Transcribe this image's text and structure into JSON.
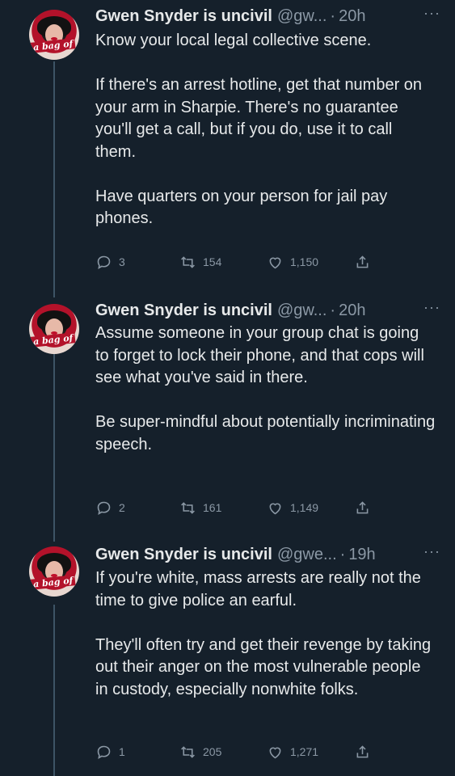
{
  "tweets": [
    {
      "name": "Gwen Snyder is uncivil",
      "handle": "@gw...",
      "dot": "·",
      "time": "20h",
      "more": "···",
      "avatar_label": "a bag of",
      "text": "Know your local legal collective scene.\n\nIf there's an arrest hotline, get that number on your arm in Sharpie. There's no guarantee you'll get a call, but if you do, use it to call them.\n\nHave quarters on your person for jail pay phones.",
      "replies": "3",
      "retweets": "154",
      "likes": "1,150"
    },
    {
      "name": "Gwen Snyder is uncivil",
      "handle": "@gw...",
      "dot": "·",
      "time": "20h",
      "more": "···",
      "avatar_label": "a bag of",
      "text": "Assume someone in your group chat is going to forget to lock their phone, and that cops will see what you've said in there.\n\nBe super-mindful about potentially incriminating speech.",
      "replies": "2",
      "retweets": "161",
      "likes": "1,149"
    },
    {
      "name": "Gwen Snyder is uncivil",
      "handle": "@gwe...",
      "dot": "·",
      "time": "19h",
      "more": "···",
      "avatar_label": "a bag of",
      "text": "If you're white, mass arrests are really not the time to give police an earful.\n\nThey'll often try and get their revenge by taking out their anger on the most vulnerable people in custody, especially nonwhite folks.",
      "replies": "1",
      "retweets": "205",
      "likes": "1,271"
    }
  ],
  "colors": {
    "background": "#15202b",
    "text": "#e7e9ea",
    "muted": "#8b98a5",
    "thread_line": "#3d5466"
  },
  "icons": [
    "reply-icon",
    "retweet-icon",
    "like-icon",
    "share-icon",
    "more-icon"
  ]
}
